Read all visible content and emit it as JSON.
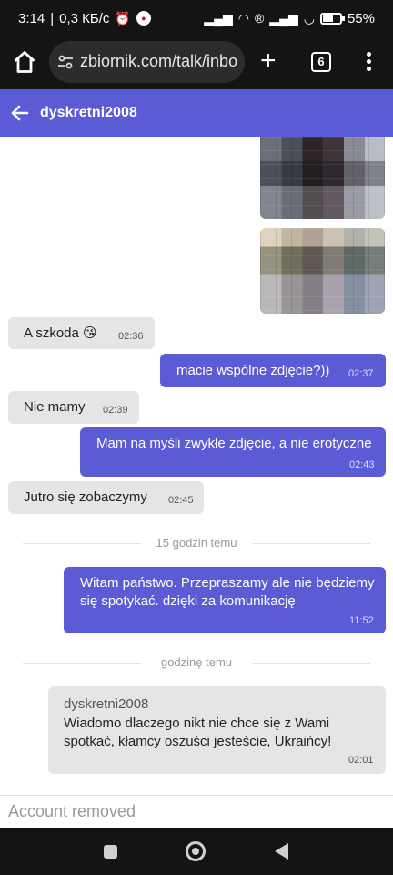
{
  "status_bar": {
    "time": "3:14",
    "speed": "0,3 КБ/с",
    "battery": "55%"
  },
  "browser": {
    "url": "zbiornik.com/talk/inbo",
    "tab_count": "6"
  },
  "chat": {
    "title": "dyskretni2008",
    "messages": [
      {
        "direction": "in",
        "text": "A szkoda 😘",
        "time": "02:36"
      },
      {
        "direction": "out",
        "text": "macie wspólne zdjęcie?))",
        "time": "02:37"
      },
      {
        "direction": "in",
        "text": "Nie mamy",
        "time": "02:39"
      },
      {
        "direction": "out",
        "text": "Mam na myśli zwykłe zdjęcie, a nie erotyczne",
        "time": "02:43"
      },
      {
        "direction": "in",
        "text": "Jutro się zobaczymy",
        "time": "02:45"
      },
      {
        "direction": "out",
        "text": "Witam państwo. Przepraszamy ale nie będziemy się spotykać. dzięki za komunikację",
        "time": "11:52"
      },
      {
        "direction": "in",
        "sender": "dyskretni2008",
        "text": "Wiadomo dlaczego nikt nie chce się z Wami spotkać, kłamcy oszuści jesteście, Ukraińcy!",
        "time": "02:01"
      }
    ],
    "dividers": [
      "15 godzin temu",
      "godzinę temu"
    ]
  },
  "footer": {
    "account_status": "Account removed"
  },
  "colors": {
    "accent": "#5b5bd6",
    "incoming_bubble": "#e5e5e5",
    "system_bar": "#141414"
  }
}
